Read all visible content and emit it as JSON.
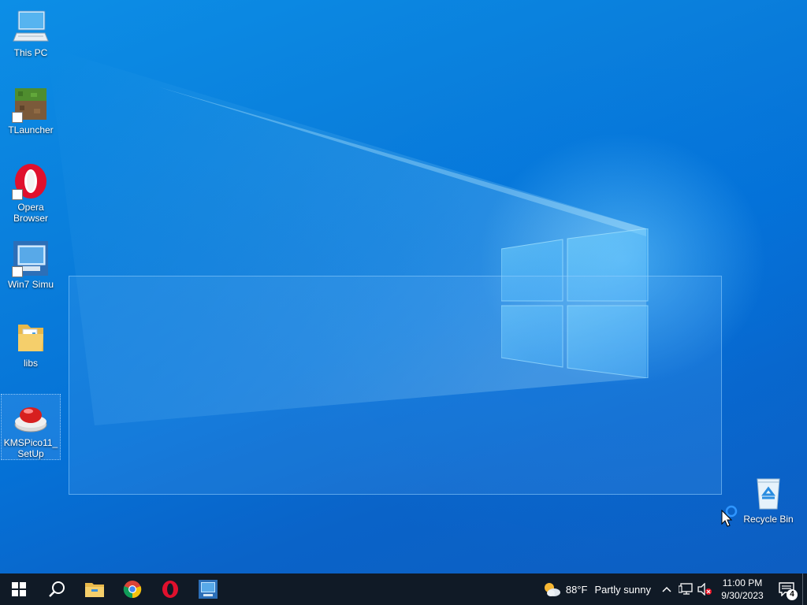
{
  "desktop": {
    "icons": [
      {
        "label": "This PC",
        "icon": "computer-icon"
      },
      {
        "label": "TLauncher",
        "icon": "grass-block-icon",
        "shortcut": true
      },
      {
        "label": "Opera Browser",
        "icon": "opera-icon",
        "shortcut": true
      },
      {
        "label": "Win7 Simu",
        "icon": "win7-simu-icon",
        "shortcut": true
      },
      {
        "label": "libs",
        "icon": "folder-icon"
      },
      {
        "label": "KMSPico11_SetUp",
        "icon": "red-button-icon",
        "selected": true
      }
    ],
    "recycle_bin": {
      "label": "Recycle Bin",
      "icon": "recycle-bin-icon"
    }
  },
  "taskbar": {
    "buttons": [
      {
        "name": "start-button",
        "icon": "windows-icon"
      },
      {
        "name": "search-button",
        "icon": "search-icon"
      },
      {
        "name": "file-explorer-button",
        "icon": "folder-icon"
      },
      {
        "name": "chrome-button",
        "icon": "chrome-icon"
      },
      {
        "name": "opera-button",
        "icon": "opera-icon"
      },
      {
        "name": "win7-simu-button",
        "icon": "win7-simu-icon"
      }
    ],
    "weather": {
      "temp": "88°F",
      "condition": "Partly sunny",
      "icon": "partly-sunny-icon"
    },
    "clock": {
      "time": "11:00 PM",
      "date": "9/30/2023"
    },
    "notifications": {
      "count": "4"
    }
  },
  "colors": {
    "accent": "#0078d7",
    "taskbar": "#101a26",
    "desktop_bg": "#0a7fdc"
  }
}
